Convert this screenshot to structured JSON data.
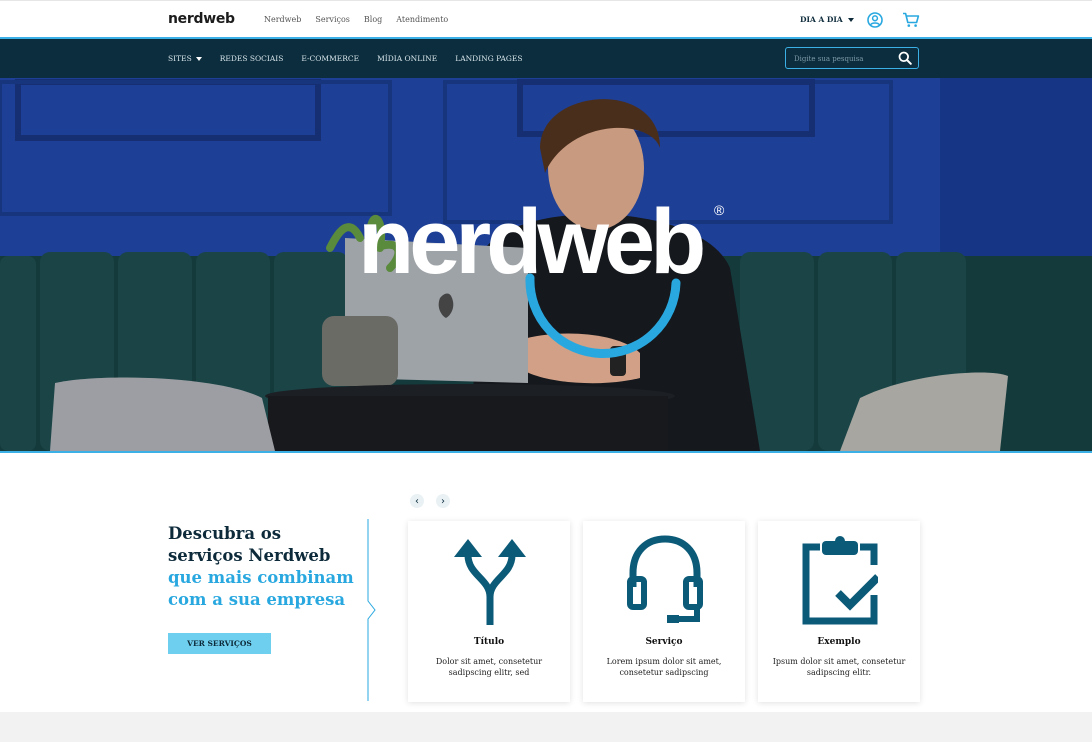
{
  "header": {
    "logo": "nerdweb",
    "links": [
      "Nerdweb",
      "Serviços",
      "Blog",
      "Atendimento"
    ],
    "dia_a_dia": "DIA A DIA",
    "icons": [
      "user-icon",
      "cart-icon"
    ]
  },
  "nav": {
    "items": [
      "SITES",
      "REDES SOCIAIS",
      "E-COMMERCE",
      "MÍDIA ONLINE",
      "LANDING PAGES"
    ],
    "search_placeholder": "Digite sua pesquisa"
  },
  "hero": {
    "logo": "nerdweb",
    "registered": "®"
  },
  "services": {
    "prev": "‹",
    "next": "›",
    "headline_dark": "Descubra os serviços Nerdweb",
    "headline_blue": "que mais combinam com a sua empresa",
    "button": "VER SERVIÇOS",
    "cards": [
      {
        "title": "Título",
        "desc": "Dolor sit amet, consetetur sadipscing elitr, sed",
        "icon": "split-arrows-icon"
      },
      {
        "title": "Serviço",
        "desc": "Lorem ipsum dolor sit amet, consetetur sadipscing",
        "icon": "headset-icon"
      },
      {
        "title": "Exemplo",
        "desc": "Ipsum dolor sit amet, consetetur sadipscing elitr.",
        "icon": "clipboard-check-icon"
      }
    ]
  },
  "colors": {
    "navy": "#0b2d3d",
    "accent_blue": "#29a8e0",
    "button_blue": "#6fcfee"
  }
}
